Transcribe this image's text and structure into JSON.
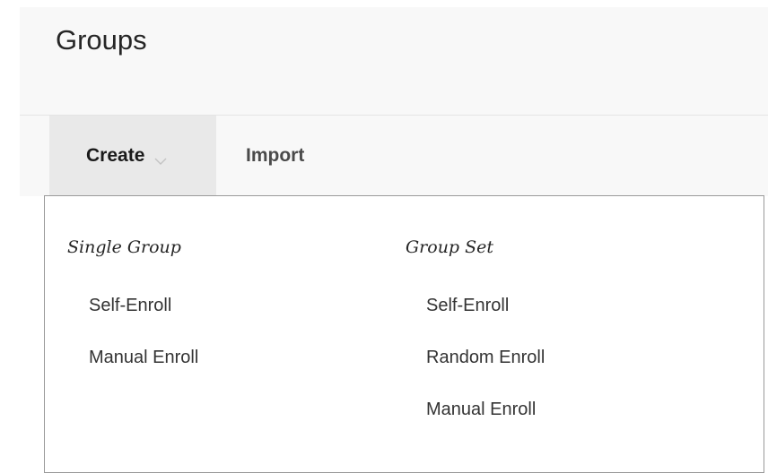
{
  "header": {
    "title": "Groups"
  },
  "toolbar": {
    "create_label": "Create",
    "import_label": "Import"
  },
  "dropdown": {
    "single_group": {
      "heading": "Single Group",
      "items": [
        {
          "label": "Self-Enroll"
        },
        {
          "label": "Manual Enroll"
        }
      ]
    },
    "group_set": {
      "heading": "Group Set",
      "items": [
        {
          "label": "Self-Enroll"
        },
        {
          "label": "Random Enroll"
        },
        {
          "label": "Manual Enroll"
        }
      ]
    }
  },
  "icons": {
    "create_dropdown": "chevron-down-icon"
  },
  "colors": {
    "page_background": "#ffffff",
    "header_background": "#f8f8f8",
    "active_tab_background": "#e9e9e9",
    "dropdown_border": "#9a9a9a",
    "text": "#262626"
  }
}
